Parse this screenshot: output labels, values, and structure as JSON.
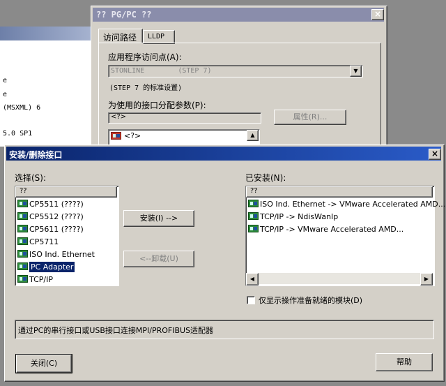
{
  "bg_window": {
    "lines": [
      "e",
      "e",
      "(MSXML) 6",
      "5.0 SP1"
    ]
  },
  "pgpc": {
    "title": "?? PG/PC ??",
    "tabs": [
      "访问路径",
      "LLDP"
    ],
    "access_point_label": "应用程序访问点(A):",
    "access_point_value": "STONLINE        (STEP 7)",
    "standard_setting": "(STEP 7 的标准设置)",
    "interface_param_label": "为使用的接口分配参数(P):",
    "interface_param_value": "<?>",
    "properties_button": "属性(R)...",
    "list_first_item": "<?>"
  },
  "dialog": {
    "title": "安装/删除接口",
    "select_label": "选择(S):",
    "installed_label": "已安装(N):",
    "select_header": "??",
    "installed_header": "??",
    "select_items": [
      "CP5511 (????)",
      "CP5512 (????)",
      "CP5611 (????)",
      "CP5711",
      "ISO Ind. Ethernet",
      "PC Adapter",
      "TCP/IP"
    ],
    "selected_index": 5,
    "installed_items": [
      "ISO Ind. Ethernet -> VMware Accelerated AMD...",
      "TCP/IP -> NdisWanIp",
      "TCP/IP -> VMware Accelerated AMD..."
    ],
    "install_button": "安装(I) -->",
    "uninstall_button": "<--卸载(U)",
    "checkbox_label": "仅显示操作准备就绪的模块(D)",
    "checkbox_checked": false,
    "description": "通过PC的串行接口或USB接口连接MPI/PROFIBUS适配器",
    "close_button": "关闭(C)",
    "help_button": "帮助"
  },
  "colors": {
    "title_active": "#0a246a",
    "title_inactive": "#8a8dab",
    "selection": "#0a246a",
    "face": "#d4d0c8"
  }
}
